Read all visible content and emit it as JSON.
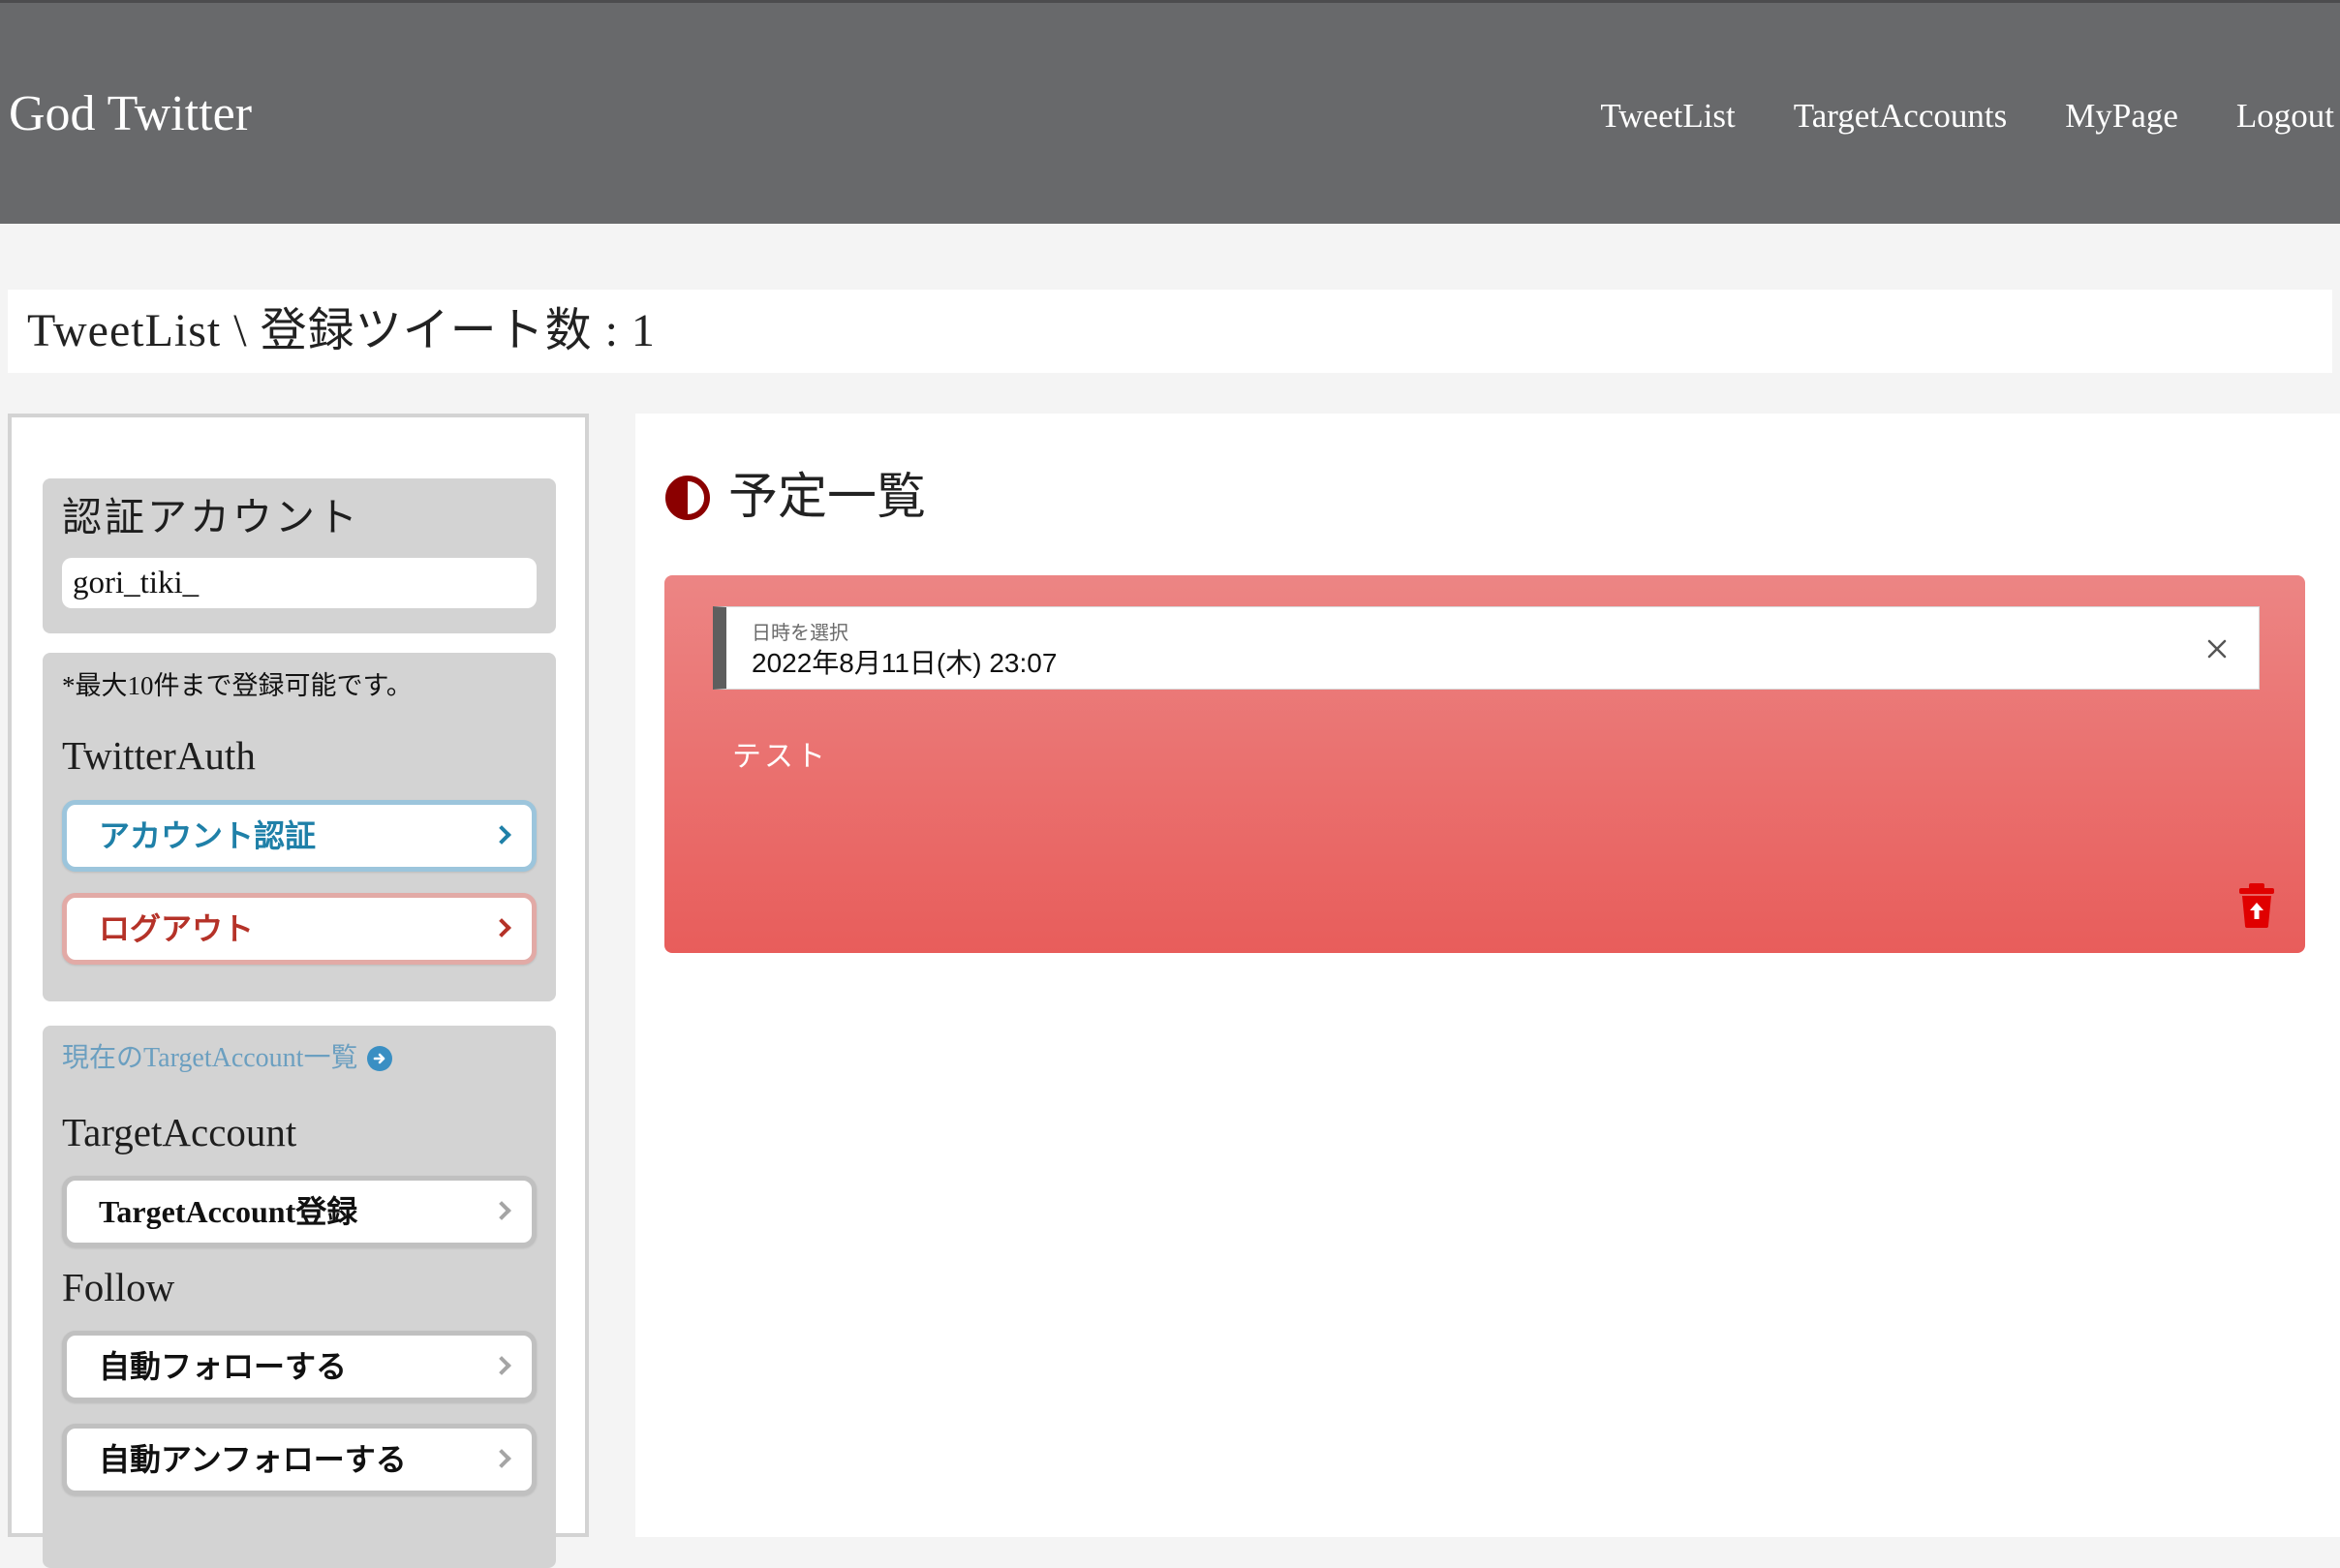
{
  "header": {
    "brand": "God Twitter",
    "nav": [
      "TweetList",
      "TargetAccounts",
      "MyPage",
      "Logout"
    ]
  },
  "titlebar": {
    "text": "TweetList \\ 登録ツイート数 : 1"
  },
  "sidebar": {
    "auth_account": {
      "heading": "認証アカウント",
      "value": "gori_tiki_"
    },
    "twitter_auth": {
      "note": "*最大10件まで登録可能です。",
      "heading": "TwitterAuth",
      "auth_button": "アカウント認証",
      "logout_button": "ログアウト"
    },
    "target": {
      "link": "現在のTargetAccount一覧",
      "heading": "TargetAccount",
      "register_button": "TargetAccount登録",
      "follow_heading": "Follow",
      "auto_follow_button": "自動フォローする",
      "auto_unfollow_button": "自動アンフォローする"
    }
  },
  "main": {
    "section_title": "予定一覧",
    "tweets": [
      {
        "date_label": "日時を選択",
        "date_value": "2022年8月11日(木) 23:07",
        "text": "テスト"
      }
    ]
  },
  "icons": {
    "section": "half-circle-icon",
    "delete": "trash-icon",
    "clear": "close-icon",
    "link": "circle-arrow-right-icon"
  },
  "colors": {
    "header_bg": "#68696b",
    "card_gradient_top": "#ec8584",
    "card_gradient_bottom": "#e85d5b",
    "accent_blue": "#1f80a8",
    "accent_red": "#b53228",
    "section_icon": "#8b0000"
  }
}
